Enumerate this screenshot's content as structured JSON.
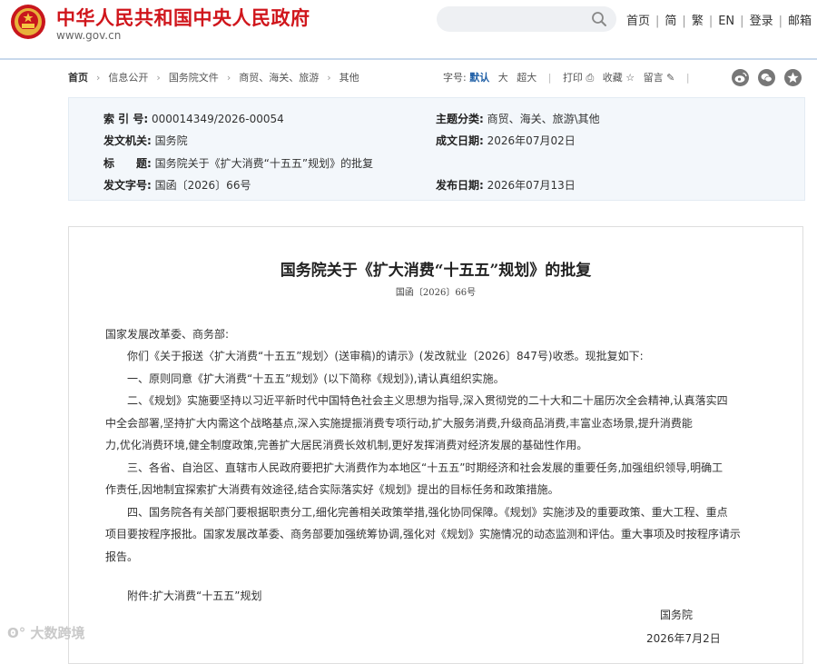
{
  "header": {
    "site_title": "中华人民共和国中央人民政府",
    "site_url": "www.gov.cn",
    "links": [
      "首页",
      "简",
      "繁",
      "EN",
      "登录",
      "邮箱"
    ]
  },
  "breadcrumb": [
    "首页",
    "信息公开",
    "国务院文件",
    "商贸、海关、旅游",
    "其他"
  ],
  "toolbar": {
    "font_label": "字号:",
    "font_default": "默认",
    "font_large": "大",
    "font_xlarge": "超大",
    "print": "打印",
    "favorite": "收藏",
    "comment": "留言"
  },
  "meta": {
    "index_key": "索 引 号:",
    "index_val": "000014349/2026-00054",
    "topic_key": "主题分类:",
    "topic_val": "商贸、海关、旅游\\其他",
    "issuer_key": "发文机关:",
    "issuer_val": "国务院",
    "date_key": "成文日期:",
    "date_val": "2026年07月02日",
    "title_key": "标　　题:",
    "title_val": "国务院关于《扩大消费“十五五”规划》的批复",
    "docno_key": "发文字号:",
    "docno_val": "国函〔2026〕66号",
    "pub_key": "发布日期:",
    "pub_val": "2026年07月13日"
  },
  "article": {
    "title": "国务院关于《扩大消费“十五五”规划》的批复",
    "doc_no": "国函〔2026〕66号",
    "lines": [
      "国家发展改革委、商务部:",
      "　　你们《关于报送〈扩大消费“十五五”规划〉(送审稿)的请示》(发改就业〔2026〕847号)收悉。现批复如下:",
      "　　一、原则同意《扩大消费“十五五”规划》(以下简称《规划》),请认真组织实施。",
      "　　二、《规划》实施要坚持以习近平新时代中国特色社会主义思想为指导,深入贯彻党的二十大和二十届历次全会精神,认真落实四",
      "中全会部署,坚持扩大内需这个战略基点,深入实施提振消费专项行动,扩大服务消费,升级商品消费,丰富业态场景,提升消费能",
      "力,优化消费环境,健全制度政策,完善扩大居民消费长效机制,更好发挥消费对经济发展的基础性作用。",
      "　　三、各省、自治区、直辖市人民政府要把扩大消费作为本地区“十五五”时期经济和社会发展的重要任务,加强组织领导,明确工",
      "作责任,因地制宜探索扩大消费有效途径,结合实际落实好《规划》提出的目标任务和政策措施。",
      "　　四、国务院各有关部门要根据职责分工,细化完善相关政策举措,强化协同保障。《规划》实施涉及的重要政策、重大工程、重点",
      "项目要按程序报批。国家发展改革委、商务部要加强统筹协调,强化对《规划》实施情况的动态监测和评估。重大事项及时按程序请示",
      "报告。"
    ],
    "attachment": "　　附件:扩大消费“十五五”规划",
    "signer": "国务院",
    "sign_date": "2026年7月2日"
  },
  "watermark": "大数跨境"
}
